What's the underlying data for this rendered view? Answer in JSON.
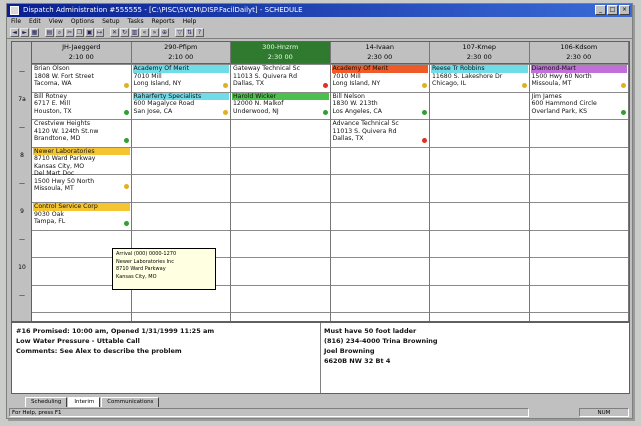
{
  "window": {
    "title": "Dispatch Administration #555555 - [C:\\PISC\\SVCM\\DISP.FacilDailyt] - SCHEDULE"
  },
  "menu": [
    "File",
    "Edit",
    "View",
    "Options",
    "Setup",
    "Tasks",
    "Reports",
    "Help"
  ],
  "toolbar": {
    "icons": [
      "back-icon",
      "forward-icon",
      "grid-icon",
      "print-icon",
      "find-icon",
      "cut-icon",
      "copy-icon",
      "paste-icon",
      "assign-icon",
      "delete-icon",
      "refresh-icon",
      "calendar-icon",
      "left-icon",
      "right-icon",
      "zoom-icon",
      "filter-icon",
      "sort-icon",
      "help-icon"
    ]
  },
  "schedule": {
    "row_times": [
      "—",
      "7a",
      "—",
      "8",
      "—",
      "9",
      "—",
      "10",
      "—"
    ],
    "technicians": [
      {
        "name": "JH-Jaeggerd",
        "time": "2:10 00",
        "selected": false
      },
      {
        "name": "290-Pfipm",
        "time": "2:10 00",
        "selected": false
      },
      {
        "name": "300-Hnzrm",
        "time": "2:30 00",
        "selected": true
      },
      {
        "name": "14-Ivaan",
        "time": "2:30 00",
        "selected": false
      },
      {
        "name": "107-Kmep",
        "time": "2:30 00",
        "selected": false
      },
      {
        "name": "106-Kdsom",
        "time": "2:30 00",
        "selected": false
      }
    ],
    "cards": [
      {
        "col": 0,
        "slot": 0,
        "rows": 3,
        "bg": "#ffffff",
        "lines": [
          "Brian Olson",
          "1808 W. Fort Street",
          "Tacoma, WA"
        ],
        "dot": "#e0b020"
      },
      {
        "col": 0,
        "slot": 3,
        "rows": 3,
        "bg": "#ffffff",
        "lines": [
          "Bill Rotney",
          "6717 E. Mill",
          "Houston, TX"
        ],
        "dot": "#30a030"
      },
      {
        "col": 0,
        "slot": 6,
        "rows": 3,
        "bg": "#ffffff",
        "lines": [
          "Crestview Heights",
          "4120 W. 124th St.nw",
          "Brandtone, MD"
        ],
        "dot": "#30a030"
      },
      {
        "col": 0,
        "slot": 9,
        "rows": 5,
        "bg": "#f5c431",
        "lines": [
          "Newer Laboratories",
          "8710 Ward Parkway",
          "Kansas City, MO",
          "Del Mart Doc",
          "1500 Hwy 50 North",
          "Missoula, MT"
        ],
        "dot": "#e0b020"
      },
      {
        "col": 0,
        "slot": 15,
        "rows": 3,
        "bg": "#f5c431",
        "lines": [
          "Control Service Corp",
          "9030 Oak",
          "Tampa, FL"
        ],
        "dot": "#30a030"
      },
      {
        "col": 1,
        "slot": 0,
        "rows": 3,
        "bg": "#6fdce8",
        "lines": [
          "Academy Of Merit",
          "7010 Mill",
          "Long Island, NY"
        ],
        "dot": "#e0b020"
      },
      {
        "col": 1,
        "slot": 3,
        "rows": 3,
        "bg": "#6fdce8",
        "lines": [
          "Raharferty Specialists",
          "600 Magalyce Road",
          "San Jose, CA"
        ],
        "dot": "#e0b020"
      },
      {
        "col": 2,
        "slot": 0,
        "rows": 3,
        "bg": "#ffffff",
        "lines": [
          "Gateway Technical Sc",
          "11013 S. Quivera Rd",
          "Dallas, TX"
        ],
        "dot": "#e03020"
      },
      {
        "col": 2,
        "slot": 3,
        "rows": 3,
        "bg": "#4cc04c",
        "lines": [
          "Harold Wicker",
          "12000 N. Malkof",
          "Underwood, NJ"
        ],
        "dot": "#30a030"
      },
      {
        "col": 3,
        "slot": 0,
        "rows": 3,
        "bg": "#f05a28",
        "lines": [
          "Academy Of Merit",
          "7010 Mill",
          "Long Island, NY"
        ],
        "dot": "#e0b020"
      },
      {
        "col": 3,
        "slot": 3,
        "rows": 3,
        "bg": "#ffffff",
        "lines": [
          "Bill Nelson",
          "1830 W. 213th",
          "Los Angeles, CA"
        ],
        "dot": "#30a030"
      },
      {
        "col": 3,
        "slot": 6,
        "rows": 3,
        "bg": "#ffffff",
        "lines": [
          "Advance Technical Sc",
          "11013 S. Quivera Rd",
          "Dallas, TX"
        ],
        "dot": "#e03020"
      },
      {
        "col": 4,
        "slot": 0,
        "rows": 3,
        "bg": "#6fdce8",
        "lines": [
          "Reese Tr Robbins",
          "11680 S. Lakeshore Dr",
          "Chicago, IL"
        ],
        "dot": "#e0b020"
      },
      {
        "col": 5,
        "slot": 0,
        "rows": 3,
        "bg": "#c070d8",
        "lines": [
          "Diamond-Mart",
          "1500 Hwy 60 North",
          "Missoula, MT"
        ],
        "dot": "#e0b020"
      },
      {
        "col": 5,
        "slot": 3,
        "rows": 3,
        "bg": "#ffffff",
        "lines": [
          "Jim James",
          "600 Hammond Circle",
          "Overland Park, KS"
        ],
        "dot": "#30a030"
      }
    ],
    "tooltip": [
      "Arrival (000) 0000-1270",
      "Newer Laboratories Inc",
      "8710 Ward Parkway",
      "Kansas City, MO"
    ]
  },
  "details": {
    "left": [
      "#16 Promised: 10:00 am, Opened 1/31/1999 11:25 am",
      "Low Water Pressure - Uttable Call",
      "Comments: See Alex to describe the problem"
    ],
    "right": [
      "Must have 50 foot ladder",
      "(816) 234-4000 Trina Browning",
      "Joel Browning",
      "6620B NW 32 Bt 4"
    ]
  },
  "tabs": [
    {
      "label": "Scheduling",
      "active": false
    },
    {
      "label": "Interim",
      "active": true
    },
    {
      "label": "Communications",
      "active": false
    }
  ],
  "status": {
    "left": "For Help, press F1",
    "right": "NUM"
  }
}
